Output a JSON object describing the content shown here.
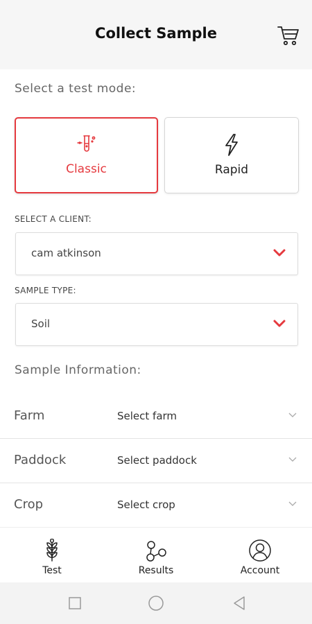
{
  "header": {
    "title": "Collect Sample",
    "cart_icon": "shopping-cart-icon"
  },
  "test_mode": {
    "label": "Select a test mode:",
    "options": [
      {
        "label": "Classic",
        "icon": "test-tube-icon",
        "selected": true
      },
      {
        "label": "Rapid",
        "icon": "lightning-bolt-icon",
        "selected": false
      }
    ]
  },
  "client": {
    "label": "SELECT A CLIENT:",
    "value": "cam atkinson"
  },
  "sample_type": {
    "label": "SAMPLE TYPE:",
    "value": "Soil"
  },
  "sample_info": {
    "label": "Sample Information:",
    "rows": [
      {
        "key": "Farm",
        "value": "Select farm"
      },
      {
        "key": "Paddock",
        "value": "Select paddock"
      },
      {
        "key": "Crop",
        "value": "Select crop"
      }
    ]
  },
  "tabs": [
    {
      "label": "Test",
      "icon": "wheat-icon"
    },
    {
      "label": "Results",
      "icon": "molecule-icon"
    },
    {
      "label": "Account",
      "icon": "user-circle-icon"
    }
  ],
  "colors": {
    "accent": "#e5393e",
    "header_bg": "#f6f6f6",
    "nav_bg": "#f3f3f3"
  }
}
